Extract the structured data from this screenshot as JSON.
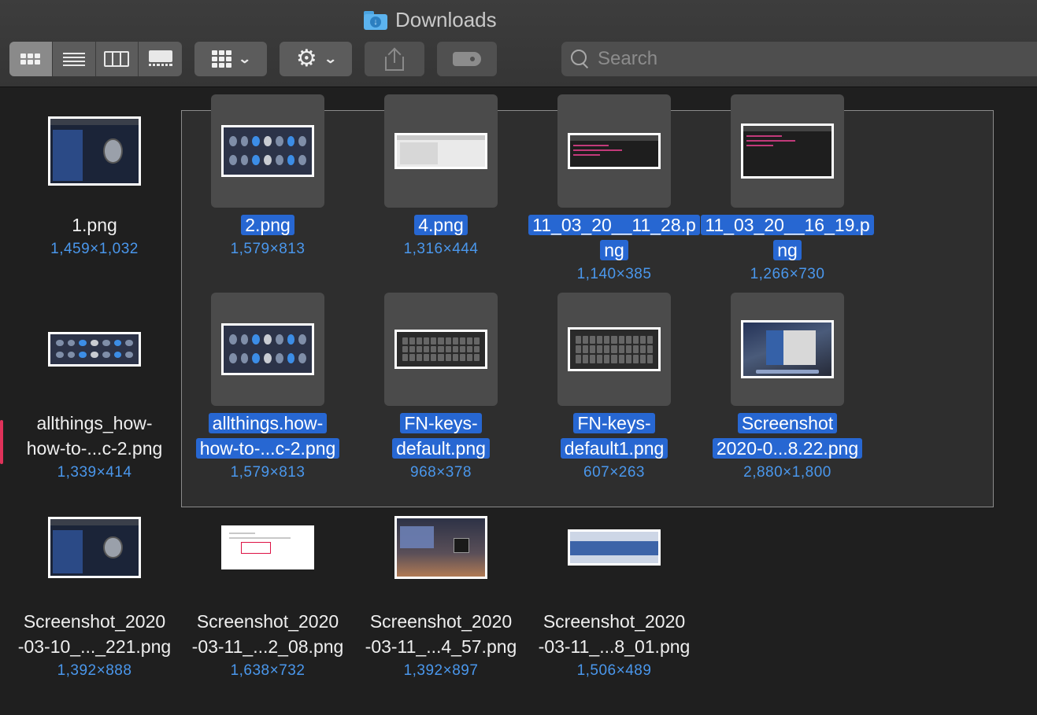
{
  "window": {
    "title": "Downloads"
  },
  "toolbar": {
    "views": [
      "icon-view",
      "list-view",
      "column-view",
      "gallery-view"
    ],
    "active_view": "icon-view",
    "group_menu": "group-by",
    "action_menu": "action",
    "share": "share",
    "tags": "tags"
  },
  "search": {
    "placeholder": "Search",
    "value": ""
  },
  "files": [
    {
      "name": "1.png",
      "dims": "1,459×1,032",
      "selected": false,
      "thumb": "prefs"
    },
    {
      "name": "2.png",
      "dims": "1,579×813",
      "selected": true,
      "thumb": "dock"
    },
    {
      "name": "4.png",
      "dims": "1,316×444",
      "selected": true,
      "thumb": "window"
    },
    {
      "name": "11_03_20__11_28.png",
      "name_lines": [
        "11_03_20__11_28.p",
        "ng"
      ],
      "dims": "1,140×385",
      "selected": true,
      "thumb": "terminal"
    },
    {
      "name": "11_03_20__16_19.png",
      "name_lines": [
        "11_03_20__16_19.p",
        "ng"
      ],
      "dims": "1,266×730",
      "selected": true,
      "thumb": "terminal"
    },
    {
      "name": "allthings_how-how-to-...c-2.png",
      "name_lines": [
        "allthings_how-",
        "how-to-...c-2.png"
      ],
      "dims": "1,339×414",
      "selected": false,
      "thumb": "dock"
    },
    {
      "name": "allthings.how-how-to-...c-2.png",
      "name_lines": [
        "allthings.how-",
        "how-to-...c-2.png"
      ],
      "dims": "1,579×813",
      "selected": true,
      "thumb": "dock"
    },
    {
      "name": "FN-keys-default.png",
      "name_lines": [
        "FN-keys-",
        "default.png"
      ],
      "dims": "968×378",
      "selected": true,
      "thumb": "keyboard"
    },
    {
      "name": "FN-keys-default1.png",
      "name_lines": [
        "FN-keys-",
        "default1.png"
      ],
      "dims": "607×263",
      "selected": true,
      "thumb": "keyboard"
    },
    {
      "name": "Screenshot 2020-0...8.22.png",
      "name_lines": [
        "Screenshot",
        "2020-0...8.22.png"
      ],
      "dims": "2,880×1,800",
      "selected": true,
      "thumb": "desktop"
    },
    {
      "name": "Screenshot_2020-03-10_..._221.png",
      "name_lines": [
        "Screenshot_2020",
        "-03-10_..._221.png"
      ],
      "dims": "1,392×888",
      "selected": false,
      "thumb": "prefs"
    },
    {
      "name": "Screenshot_2020-03-11_...2_08.png",
      "name_lines": [
        "Screenshot_2020",
        "-03-11_...2_08.png"
      ],
      "dims": "1,638×732",
      "selected": false,
      "thumb": "google"
    },
    {
      "name": "Screenshot_2020-03-11_...4_57.png",
      "name_lines": [
        "Screenshot_2020",
        "-03-11_...4_57.png"
      ],
      "dims": "1,392×897",
      "selected": false,
      "thumb": "mojave"
    },
    {
      "name": "Screenshot_2020-03-11_...8_01.png",
      "name_lines": [
        "Screenshot_2020",
        "-03-11_...8_01.png"
      ],
      "dims": "1,506×489",
      "selected": false,
      "thumb": "bluebar"
    }
  ],
  "colors": {
    "selection": "#2767d2",
    "dimensions_text": "#4a97ec",
    "background": "#1f1f1f",
    "toolbar": "#3a3a3a"
  }
}
